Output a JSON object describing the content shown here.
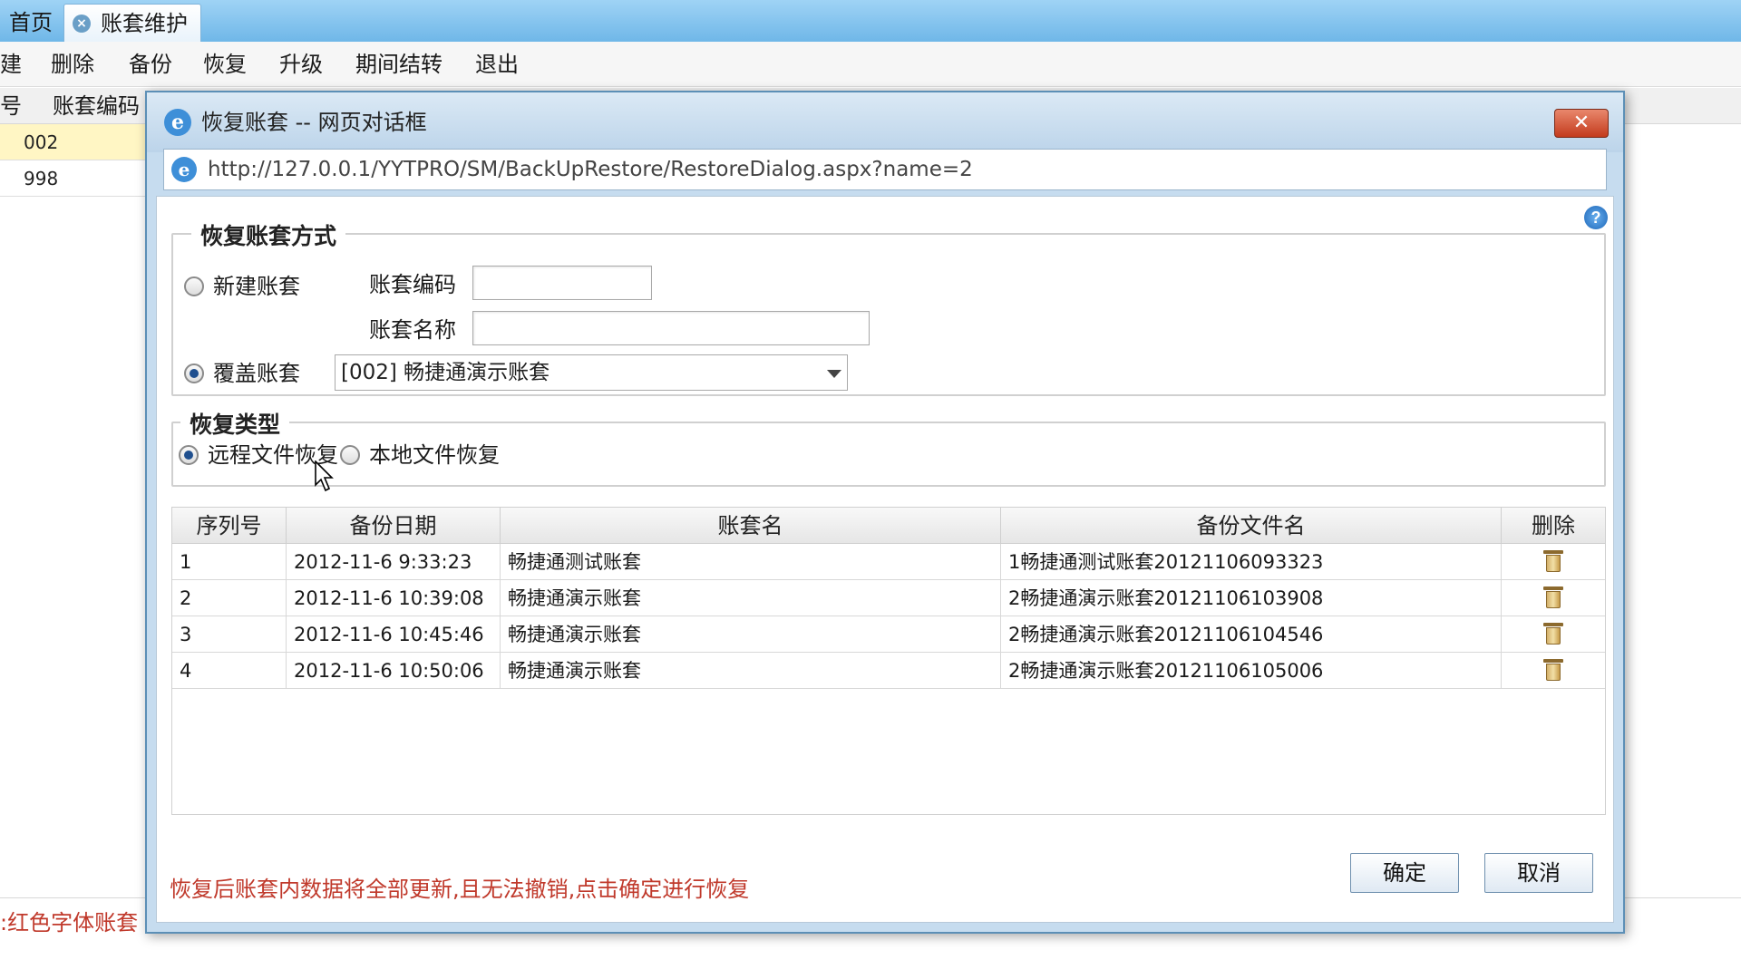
{
  "tabs": {
    "home": "首页",
    "maintenance": "账套维护",
    "close_glyph": "×"
  },
  "toolbar": {
    "new": "建",
    "delete": "删除",
    "backup": "备份",
    "restore": "恢复",
    "upgrade": "升级",
    "period_close": "期间结转",
    "exit": "退出"
  },
  "background_grid": {
    "col_no": "号",
    "col_code": "账套编码",
    "rows": [
      "002",
      "998"
    ]
  },
  "background_note": ":红色字体账套",
  "dialog": {
    "title": "恢复账套 -- 网页对话框",
    "close_glyph": "✕",
    "address_url": "http://127.0.0.1/YYTPRO/SM/BackUpRestore/RestoreDialog.aspx?name=2",
    "help_glyph": "?",
    "method": {
      "legend": "恢复账套方式",
      "new_label": "新建账套",
      "code_label": "账套编码",
      "code_value": "",
      "name_label": "账套名称",
      "name_value": "",
      "overwrite_label": "覆盖账套",
      "overwrite_value": "[002] 畅捷通演示账套",
      "selected": "overwrite"
    },
    "type": {
      "legend": "恢复类型",
      "remote_label": "远程文件恢复",
      "local_label": "本地文件恢复",
      "selected": "remote"
    },
    "table": {
      "columns": [
        "序列号",
        "备份日期",
        "账套名",
        "备份文件名",
        "删除"
      ],
      "rows": [
        {
          "no": "1",
          "date": "2012-11-6 9:33:23",
          "name": "畅捷通测试账套",
          "file": "1畅捷通测试账套20121106093323"
        },
        {
          "no": "2",
          "date": "2012-11-6 10:39:08",
          "name": "畅捷通演示账套",
          "file": "2畅捷通演示账套20121106103908"
        },
        {
          "no": "3",
          "date": "2012-11-6 10:45:46",
          "name": "畅捷通演示账套",
          "file": "2畅捷通演示账套20121106104546"
        },
        {
          "no": "4",
          "date": "2012-11-6 10:50:06",
          "name": "畅捷通演示账套",
          "file": "2畅捷通演示账套20121106105006"
        }
      ]
    },
    "warning": "恢复后账套内数据将全部更新,且无法撤销,点击确定进行恢复",
    "ok_label": "确定",
    "cancel_label": "取消"
  },
  "colors": {
    "warning_text": "#c0392b",
    "titlebar": "#c6dcef",
    "close_button": "#c33b1d"
  }
}
